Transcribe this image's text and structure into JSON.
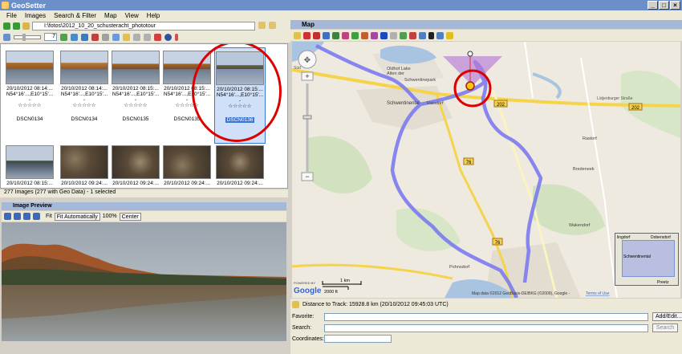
{
  "app": {
    "title": "GeoSetter"
  },
  "menu": [
    "File",
    "Images",
    "Search & Filter",
    "Map",
    "View",
    "Help"
  ],
  "path": {
    "value": "I:\\fotos\\2012_10_20_schusteracht_phototour"
  },
  "toolbar": {
    "zoom_value": "7"
  },
  "thumbnails": [
    {
      "date": "20/10/2012 08:14:...",
      "coords": "N54°16'...,E10°15'...",
      "dash": "-",
      "stars": "☆☆☆☆☆",
      "name": "DSCN0134",
      "selected": false
    },
    {
      "date": "20/10/2012 08:14:...",
      "coords": "N54°16'...,E10°15'...",
      "dash": "-",
      "stars": "☆☆☆☆☆",
      "name": "DSCN0134",
      "selected": false
    },
    {
      "date": "20/10/2012 08:15:...",
      "coords": "N54°16'...,E10°15'...",
      "dash": "-",
      "stars": "☆☆☆☆☆",
      "name": "DSCN0135",
      "selected": false
    },
    {
      "date": "20/10/2012 08:15:...",
      "coords": "N54°16'...,E10°15'...",
      "dash": "-",
      "stars": "☆☆☆☆☆",
      "name": "DSCN0135",
      "selected": false
    },
    {
      "date": "20/10/2012 08:15:...",
      "coords": "N54°16'...,E10°15'...",
      "dash": "-",
      "stars": "☆☆☆☆☆",
      "name": "DSCN0136",
      "selected": true
    }
  ],
  "thumbnails_row2": [
    {
      "date": "20/10/2012 08:15:..."
    },
    {
      "date": "20/10/2012 09:24:..."
    },
    {
      "date": "20/10/2012 09:24:..."
    },
    {
      "date": "20/10/2012 09:24:..."
    },
    {
      "date": "20/10/2012 09:24:..."
    }
  ],
  "status": {
    "images": "277 Images (277 with Geo Data) - 1 selected"
  },
  "preview": {
    "title": "Image Preview",
    "fit_label": "Fit",
    "fit_auto": "Fit Automatically",
    "zoom": "100%",
    "center": "Center"
  },
  "map": {
    "title": "Map",
    "labels": {
      "oldhof": "Oldhof Lake",
      "oldhof2": "Alten der",
      "schwentinepark": "Schwentinepark",
      "schwentinental": "Schwentinental",
      "raisdorf": "Raisdorf",
      "rastorf": "Rastorf",
      "bredeneek": "Bredeneek",
      "wakendorf": "Wakendorf",
      "pohnsdorf": "Pohnsdorf",
      "luetjenburger": "Lütjenburger Straße",
      "sud": "Süd"
    },
    "road_numbers": [
      "202",
      "202",
      "76",
      "76"
    ],
    "inset": {
      "label1": "Dobersdorf",
      "label2": "Schwentinental",
      "label3": "Preetz",
      "label4": "lingdorf"
    },
    "scale": {
      "km": "1 km",
      "ft": "2000 ft"
    },
    "powered": "POWERED BY",
    "google": "Google",
    "copyright": "Map data ©2012 GeoBasis-DE/BKG (©2009), Google - ",
    "terms": "Terms of Use"
  },
  "distance": {
    "text": "Distance to Track: 15928.8 km (20/10/2012 09:45:03 UTC)"
  },
  "form": {
    "favorite_label": "Favorite:",
    "search_label": "Search:",
    "coords_label": "Coordinates:",
    "add_edit": "Add/Edit...",
    "search_btn": "Search"
  },
  "colors": {
    "track": "#7b7bef",
    "annotation": "#dd0000",
    "titlebar": "#6b8fc9",
    "panel_head": "#a6b8d8"
  }
}
